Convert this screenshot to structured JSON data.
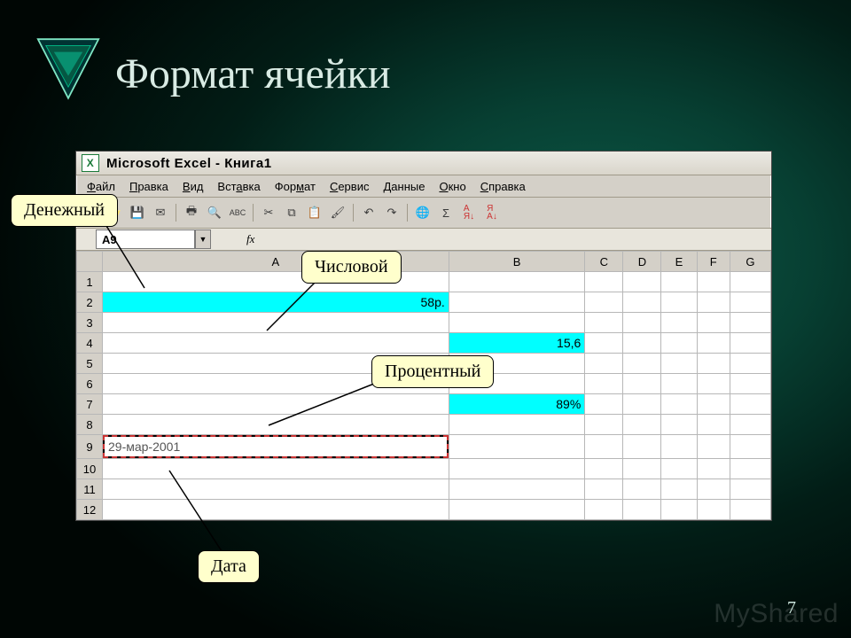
{
  "slide": {
    "title": "Формат ячейки",
    "page_number": "7",
    "watermark": "MyShared"
  },
  "excel": {
    "window_title": "Microsoft Excel - Книга1",
    "menu": [
      "Файл",
      "Правка",
      "Вид",
      "Вставка",
      "Формат",
      "Сервис",
      "Данные",
      "Окно",
      "Справка"
    ],
    "namebox": "A9",
    "fx_label": "fx",
    "columns": [
      "A",
      "B",
      "C",
      "D",
      "E",
      "F",
      "G"
    ],
    "row_count": 12,
    "cells": {
      "A2": "58р.",
      "B4": "15,6",
      "B7": "89%",
      "A9": "29-мар-2001"
    }
  },
  "callouts": {
    "money": "Денежный",
    "number": "Числовой",
    "percent": "Процентный",
    "date": "Дата"
  }
}
